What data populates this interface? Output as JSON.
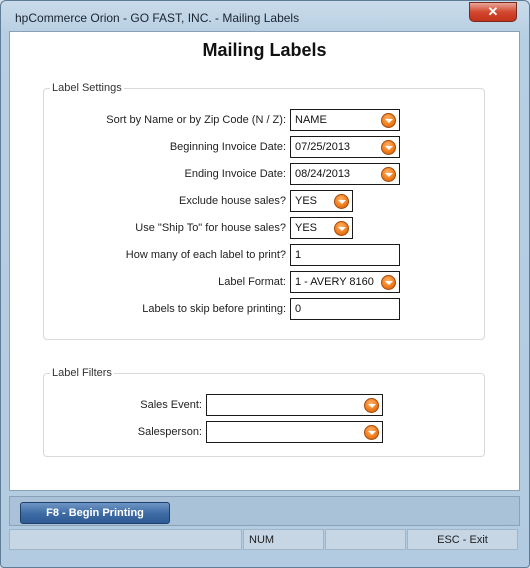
{
  "window": {
    "title": "hpCommerce Orion - GO FAST, INC. - Mailing Labels",
    "close_label": "✕"
  },
  "page_title": "Mailing Labels",
  "label_settings": {
    "group_label": "Label Settings",
    "fields": [
      {
        "label": "Sort by Name or by Zip Code (N / Z):",
        "value": "NAME",
        "type": "dropdown"
      },
      {
        "label": "Beginning Invoice Date:",
        "value": "07/25/2013",
        "type": "date-dropdown"
      },
      {
        "label": "Ending Invoice Date:",
        "value": "08/24/2013",
        "type": "date-dropdown"
      },
      {
        "label": "Exclude house sales?",
        "value": "YES",
        "type": "dropdown"
      },
      {
        "label": "Use \"Ship To\" for house sales?",
        "value": "YES",
        "type": "dropdown"
      },
      {
        "label": "How many of each label to print?",
        "value": "1",
        "type": "text"
      },
      {
        "label": "Label Format:",
        "value": "1 - AVERY 8160",
        "type": "dropdown"
      },
      {
        "label": "Labels to skip before printing:",
        "value": "0",
        "type": "text"
      }
    ]
  },
  "label_filters": {
    "group_label": "Label Filters",
    "fields": [
      {
        "label": "Sales Event:",
        "value": "",
        "type": "dropdown"
      },
      {
        "label": "Salesperson:",
        "value": "",
        "type": "dropdown"
      }
    ]
  },
  "actions": {
    "begin_printing_label": "F8 - Begin Printing"
  },
  "statusbar": {
    "cells": [
      "",
      "NUM",
      "",
      "ESC - Exit"
    ]
  },
  "icons": {
    "dropdown": "chevron-down-icon",
    "close": "close-icon"
  },
  "colors": {
    "accent": "#3d6aa3",
    "dropdown_button": "#ef7a19",
    "close_button": "#d2472e"
  }
}
